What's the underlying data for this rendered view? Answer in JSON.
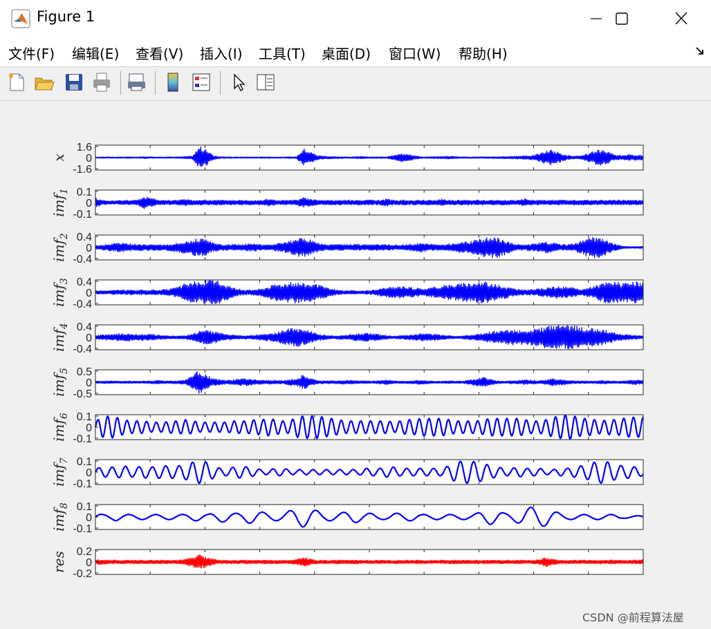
{
  "window": {
    "title": "Figure 1",
    "icon": "matlab-logo-icon",
    "controls": [
      "minimize-icon",
      "maximize-icon",
      "close-icon"
    ]
  },
  "menu": {
    "items": [
      "文件(F)",
      "编辑(E)",
      "查看(V)",
      "插入(I)",
      "工具(T)",
      "桌面(D)",
      "窗口(W)",
      "帮助(H)"
    ]
  },
  "toolbar": {
    "icons": [
      "new-figure-icon",
      "open-file-icon",
      "save-icon",
      "print-icon",
      "print-preview-icon",
      "colorbar-icon",
      "legend-icon",
      "edit-plot-arrow-icon",
      "property-inspector-icon"
    ]
  },
  "watermark": "CSDN @前程算法屋",
  "colors": {
    "signal": "#0000ff",
    "residual": "#ff0000",
    "axes": "#262626",
    "background": "#f0f0f0"
  },
  "chart_data": [
    {
      "type": "line",
      "ylabel": "x",
      "ylim": [
        -1.6,
        1.6
      ],
      "yticks": [
        "1.6",
        "0",
        "-1.6"
      ],
      "color": "#0000ff",
      "description_of_shape": "broadband bursts",
      "envelope": [
        0.08,
        0.1,
        0.09,
        0.08,
        0.1,
        0.09,
        0.08,
        0.12,
        0.1,
        0.09,
        0.08,
        0.1,
        0.1,
        0.15,
        0.2,
        1.5,
        1.0,
        0.3,
        0.12,
        0.1,
        0.08,
        0.09,
        0.08,
        0.09,
        0.1,
        0.1,
        0.09,
        0.08,
        0.1,
        0.12,
        1.2,
        0.8,
        0.3,
        0.2,
        0.15,
        0.12,
        0.1,
        0.1,
        0.15,
        0.12,
        0.1,
        0.1,
        0.1,
        0.3,
        0.5,
        0.6,
        0.3,
        0.1,
        0.1,
        0.12,
        0.15,
        0.2,
        0.15,
        0.1,
        0.1,
        0.1,
        0.1,
        0.12,
        0.12,
        0.15,
        0.15,
        0.2,
        0.25,
        0.3,
        0.5,
        0.9,
        1.0,
        0.6,
        0.3,
        0.2,
        0.2,
        0.5,
        0.9,
        1.0,
        0.7,
        0.3,
        0.3,
        0.4,
        0.35,
        0.3
      ]
    },
    {
      "type": "line",
      "ylabel": "imf1",
      "ylim": [
        -0.1,
        0.1
      ],
      "yticks": [
        "0.1",
        "0",
        "-0.1"
      ],
      "color": "#0000ff",
      "envelope": [
        0.04,
        0.02,
        0.015,
        0.015,
        0.02,
        0.02,
        0.02,
        0.05,
        0.04,
        0.02,
        0.02,
        0.02,
        0.02,
        0.03,
        0.02,
        0.02,
        0.02,
        0.02,
        0.02,
        0.02,
        0.02,
        0.02,
        0.02,
        0.02,
        0.02,
        0.03,
        0.02,
        0.02,
        0.02,
        0.02,
        0.04,
        0.03,
        0.02,
        0.02,
        0.02,
        0.02,
        0.02,
        0.02,
        0.02,
        0.02,
        0.02,
        0.02,
        0.03,
        0.02,
        0.02,
        0.02,
        0.02,
        0.02,
        0.02,
        0.02,
        0.03,
        0.02,
        0.02,
        0.02,
        0.02,
        0.02,
        0.02,
        0.02,
        0.02,
        0.02,
        0.02,
        0.02,
        0.03,
        0.02,
        0.02,
        0.02,
        0.02,
        0.02,
        0.02,
        0.02,
        0.02,
        0.02,
        0.02,
        0.02,
        0.02,
        0.02,
        0.02,
        0.02,
        0.02,
        0.02
      ]
    },
    {
      "type": "line",
      "ylabel": "imf2",
      "ylim": [
        -0.4,
        0.4
      ],
      "yticks": [
        "0.4",
        "0",
        "-0.4"
      ],
      "color": "#0000ff",
      "envelope": [
        0.06,
        0.08,
        0.12,
        0.15,
        0.14,
        0.12,
        0.1,
        0.12,
        0.1,
        0.1,
        0.1,
        0.12,
        0.15,
        0.2,
        0.25,
        0.3,
        0.25,
        0.15,
        0.1,
        0.1,
        0.1,
        0.1,
        0.12,
        0.12,
        0.1,
        0.1,
        0.12,
        0.15,
        0.2,
        0.28,
        0.3,
        0.25,
        0.15,
        0.1,
        0.1,
        0.1,
        0.1,
        0.1,
        0.1,
        0.1,
        0.1,
        0.1,
        0.1,
        0.08,
        0.08,
        0.1,
        0.12,
        0.15,
        0.12,
        0.1,
        0.1,
        0.12,
        0.15,
        0.18,
        0.2,
        0.25,
        0.3,
        0.35,
        0.32,
        0.25,
        0.15,
        0.1,
        0.1,
        0.12,
        0.15,
        0.18,
        0.15,
        0.1,
        0.1,
        0.12,
        0.2,
        0.3,
        0.35,
        0.3,
        0.2,
        0.1,
        0.05,
        0.03,
        0.03,
        0.04
      ]
    },
    {
      "type": "line",
      "ylabel": "imf3",
      "ylim": [
        -0.4,
        0.4
      ],
      "yticks": [
        "0.4",
        "0",
        "-0.4"
      ],
      "color": "#0000ff",
      "envelope": [
        0.06,
        0.06,
        0.06,
        0.08,
        0.08,
        0.08,
        0.08,
        0.08,
        0.08,
        0.08,
        0.1,
        0.12,
        0.18,
        0.3,
        0.35,
        0.35,
        0.4,
        0.4,
        0.35,
        0.25,
        0.15,
        0.1,
        0.08,
        0.1,
        0.12,
        0.2,
        0.28,
        0.3,
        0.32,
        0.35,
        0.3,
        0.3,
        0.25,
        0.18,
        0.12,
        0.08,
        0.06,
        0.06,
        0.05,
        0.06,
        0.08,
        0.12,
        0.15,
        0.18,
        0.2,
        0.18,
        0.15,
        0.12,
        0.15,
        0.18,
        0.22,
        0.25,
        0.28,
        0.3,
        0.32,
        0.35,
        0.35,
        0.3,
        0.25,
        0.2,
        0.15,
        0.1,
        0.08,
        0.1,
        0.12,
        0.15,
        0.18,
        0.2,
        0.18,
        0.15,
        0.1,
        0.15,
        0.2,
        0.3,
        0.35,
        0.35,
        0.3,
        0.32,
        0.35,
        0.32
      ]
    },
    {
      "type": "line",
      "ylabel": "imf4",
      "ylim": [
        -0.4,
        0.4
      ],
      "yticks": [
        "0.4",
        "0",
        "-0.4"
      ],
      "color": "#0000ff",
      "envelope": [
        0.06,
        0.08,
        0.1,
        0.12,
        0.12,
        0.12,
        0.1,
        0.1,
        0.1,
        0.08,
        0.06,
        0.05,
        0.05,
        0.06,
        0.12,
        0.2,
        0.22,
        0.2,
        0.15,
        0.1,
        0.08,
        0.06,
        0.06,
        0.08,
        0.1,
        0.12,
        0.15,
        0.22,
        0.28,
        0.3,
        0.25,
        0.2,
        0.12,
        0.08,
        0.06,
        0.06,
        0.08,
        0.1,
        0.12,
        0.14,
        0.12,
        0.1,
        0.06,
        0.04,
        0.06,
        0.08,
        0.1,
        0.12,
        0.12,
        0.1,
        0.08,
        0.06,
        0.04,
        0.05,
        0.08,
        0.1,
        0.15,
        0.18,
        0.2,
        0.22,
        0.25,
        0.22,
        0.25,
        0.28,
        0.3,
        0.35,
        0.38,
        0.4,
        0.4,
        0.38,
        0.35,
        0.3,
        0.28,
        0.25,
        0.2,
        0.15,
        0.1,
        0.08,
        0.06,
        0.05
      ]
    },
    {
      "type": "line",
      "ylabel": "imf5",
      "ylim": [
        -0.5,
        0.5
      ],
      "yticks": [
        "0.5",
        "0",
        "-0.5"
      ],
      "color": "#0000ff",
      "envelope": [
        0.05,
        0.05,
        0.06,
        0.05,
        0.05,
        0.05,
        0.05,
        0.05,
        0.06,
        0.08,
        0.06,
        0.06,
        0.06,
        0.1,
        0.3,
        0.5,
        0.3,
        0.15,
        0.1,
        0.08,
        0.1,
        0.15,
        0.15,
        0.1,
        0.08,
        0.08,
        0.08,
        0.06,
        0.12,
        0.15,
        0.3,
        0.15,
        0.08,
        0.06,
        0.06,
        0.06,
        0.08,
        0.08,
        0.06,
        0.06,
        0.05,
        0.08,
        0.1,
        0.05,
        0.05,
        0.06,
        0.08,
        0.1,
        0.06,
        0.05,
        0.05,
        0.06,
        0.05,
        0.05,
        0.1,
        0.15,
        0.2,
        0.12,
        0.06,
        0.05,
        0.06,
        0.08,
        0.1,
        0.08,
        0.06,
        0.1,
        0.15,
        0.12,
        0.08,
        0.06,
        0.06,
        0.05,
        0.05,
        0.08,
        0.06,
        0.05,
        0.05,
        0.08,
        0.1,
        0.08
      ]
    },
    {
      "type": "line",
      "ylabel": "imf6",
      "ylim": [
        -0.1,
        0.1
      ],
      "yticks": [
        "0.1",
        "0",
        "-0.1"
      ],
      "color": "#0000ff",
      "envelope": [
        0.05,
        0.08,
        0.09,
        0.08,
        0.06,
        0.05,
        0.05,
        0.05,
        0.04,
        0.04,
        0.04,
        0.05,
        0.05,
        0.06,
        0.05,
        0.04,
        0.04,
        0.04,
        0.04,
        0.04,
        0.05,
        0.05,
        0.05,
        0.06,
        0.06,
        0.07,
        0.06,
        0.05,
        0.05,
        0.08,
        0.09,
        0.09,
        0.09,
        0.08,
        0.07,
        0.06,
        0.05,
        0.05,
        0.05,
        0.05,
        0.05,
        0.05,
        0.05,
        0.04,
        0.05,
        0.06,
        0.06,
        0.07,
        0.07,
        0.07,
        0.07,
        0.06,
        0.05,
        0.05,
        0.05,
        0.05,
        0.06,
        0.07,
        0.07,
        0.07,
        0.07,
        0.07,
        0.06,
        0.05,
        0.05,
        0.06,
        0.08,
        0.09,
        0.1,
        0.09,
        0.07,
        0.07,
        0.06,
        0.05,
        0.06,
        0.06,
        0.07,
        0.08,
        0.08,
        0.08
      ]
    },
    {
      "type": "line",
      "ylabel": "imf7",
      "ylim": [
        -0.1,
        0.1
      ],
      "yticks": [
        "0.1",
        "0",
        "-0.1"
      ],
      "color": "#0000ff",
      "envelope": [
        0.03,
        0.04,
        0.04,
        0.04,
        0.05,
        0.04,
        0.04,
        0.05,
        0.04,
        0.05,
        0.05,
        0.05,
        0.05,
        0.06,
        0.08,
        0.09,
        0.08,
        0.05,
        0.03,
        0.03,
        0.04,
        0.05,
        0.04,
        0.03,
        0.02,
        0.02,
        0.03,
        0.03,
        0.02,
        0.02,
        0.02,
        0.02,
        0.02,
        0.02,
        0.02,
        0.02,
        0.02,
        0.02,
        0.02,
        0.03,
        0.03,
        0.03,
        0.04,
        0.04,
        0.03,
        0.03,
        0.03,
        0.03,
        0.03,
        0.03,
        0.03,
        0.05,
        0.08,
        0.09,
        0.09,
        0.08,
        0.07,
        0.05,
        0.04,
        0.03,
        0.03,
        0.04,
        0.03,
        0.03,
        0.03,
        0.02,
        0.02,
        0.03,
        0.03,
        0.04,
        0.05,
        0.06,
        0.08,
        0.09,
        0.08,
        0.06,
        0.05,
        0.05,
        0.04,
        0.03
      ]
    },
    {
      "type": "line",
      "ylabel": "imf8",
      "ylim": [
        -0.1,
        0.1
      ],
      "yticks": [
        "0.1",
        "0",
        "-0.1"
      ],
      "color": "#0000ff",
      "envelope": [
        0.03,
        0.02,
        0.02,
        0.03,
        0.02,
        0.02,
        0.02,
        0.02,
        0.02,
        0.02,
        0.02,
        0.02,
        0.02,
        0.02,
        0.03,
        0.03,
        0.02,
        0.03,
        0.04,
        0.04,
        0.03,
        0.03,
        0.05,
        0.05,
        0.04,
        0.03,
        0.03,
        0.03,
        0.05,
        0.07,
        0.08,
        0.07,
        0.05,
        0.03,
        0.03,
        0.03,
        0.04,
        0.05,
        0.04,
        0.03,
        0.03,
        0.02,
        0.02,
        0.03,
        0.03,
        0.03,
        0.03,
        0.02,
        0.02,
        0.02,
        0.02,
        0.02,
        0.02,
        0.02,
        0.02,
        0.03,
        0.05,
        0.06,
        0.05,
        0.03,
        0.03,
        0.05,
        0.07,
        0.08,
        0.08,
        0.07,
        0.05,
        0.03,
        0.02,
        0.02,
        0.02,
        0.02,
        0.02,
        0.02,
        0.02,
        0.02,
        0.01,
        0.01,
        0.01,
        0.01
      ]
    },
    {
      "type": "line",
      "ylabel": "res",
      "ylim": [
        -0.2,
        0.2
      ],
      "yticks": [
        "0.2",
        "0",
        "-0.2"
      ],
      "color": "#ff0000",
      "envelope": [
        0.04,
        0.04,
        0.03,
        0.03,
        0.03,
        0.03,
        0.03,
        0.03,
        0.03,
        0.03,
        0.03,
        0.03,
        0.03,
        0.05,
        0.08,
        0.12,
        0.08,
        0.05,
        0.03,
        0.03,
        0.03,
        0.03,
        0.03,
        0.03,
        0.03,
        0.03,
        0.03,
        0.03,
        0.03,
        0.04,
        0.08,
        0.05,
        0.03,
        0.03,
        0.03,
        0.03,
        0.03,
        0.03,
        0.03,
        0.03,
        0.03,
        0.03,
        0.03,
        0.03,
        0.03,
        0.03,
        0.03,
        0.03,
        0.03,
        0.03,
        0.03,
        0.03,
        0.03,
        0.03,
        0.03,
        0.03,
        0.03,
        0.03,
        0.03,
        0.03,
        0.03,
        0.03,
        0.03,
        0.03,
        0.04,
        0.08,
        0.05,
        0.03,
        0.03,
        0.03,
        0.03,
        0.03,
        0.03,
        0.03,
        0.03,
        0.03,
        0.03,
        0.03,
        0.03,
        0.04
      ]
    }
  ]
}
